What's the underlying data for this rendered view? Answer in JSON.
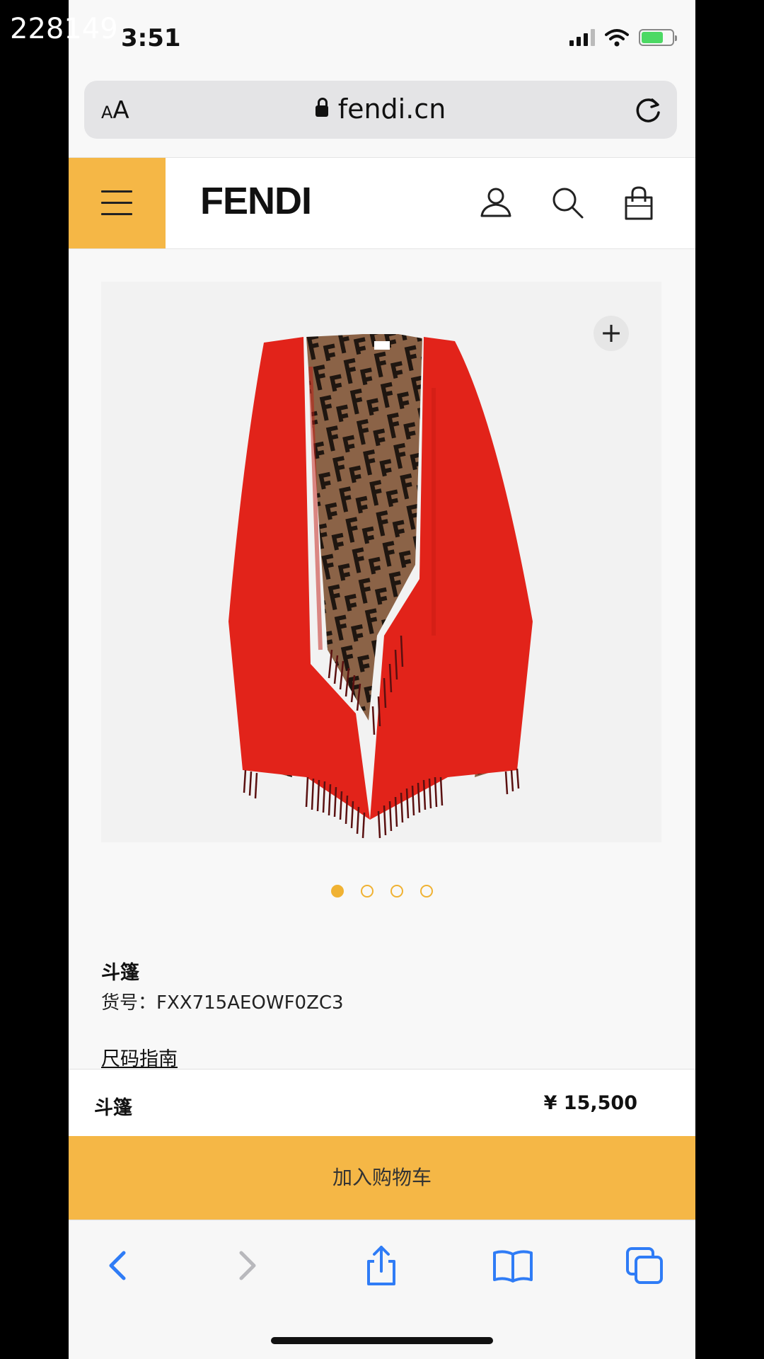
{
  "overlay": {
    "id_text": "228149"
  },
  "status_bar": {
    "time": "3:51"
  },
  "browser": {
    "text_size_small": "A",
    "text_size_large": "A",
    "url": "fendi.cn"
  },
  "header": {
    "logo": "FENDI",
    "icons": [
      "menu-icon",
      "user-icon",
      "search-icon",
      "shopping-bag-icon"
    ],
    "accent_color": "#f5b746"
  },
  "product": {
    "zoom_symbol": "+",
    "name": "斗篷",
    "sku": "货号：FXX715AEOWF0ZC3",
    "size_guide": "尺码指南",
    "image_count": 4,
    "active_image": 1,
    "colors": {
      "cape": "#e2231a",
      "lining": "#8b6347",
      "pattern": "#1f1610"
    }
  },
  "sticky_bar": {
    "name": "斗篷",
    "price": "¥ 15,500"
  },
  "cta": {
    "add_to_cart": "加入购物车"
  },
  "toolbar": {
    "icons": [
      "back-icon",
      "forward-icon",
      "share-icon",
      "bookmarks-icon",
      "tabs-icon"
    ],
    "tint": "#2f7cf6"
  }
}
